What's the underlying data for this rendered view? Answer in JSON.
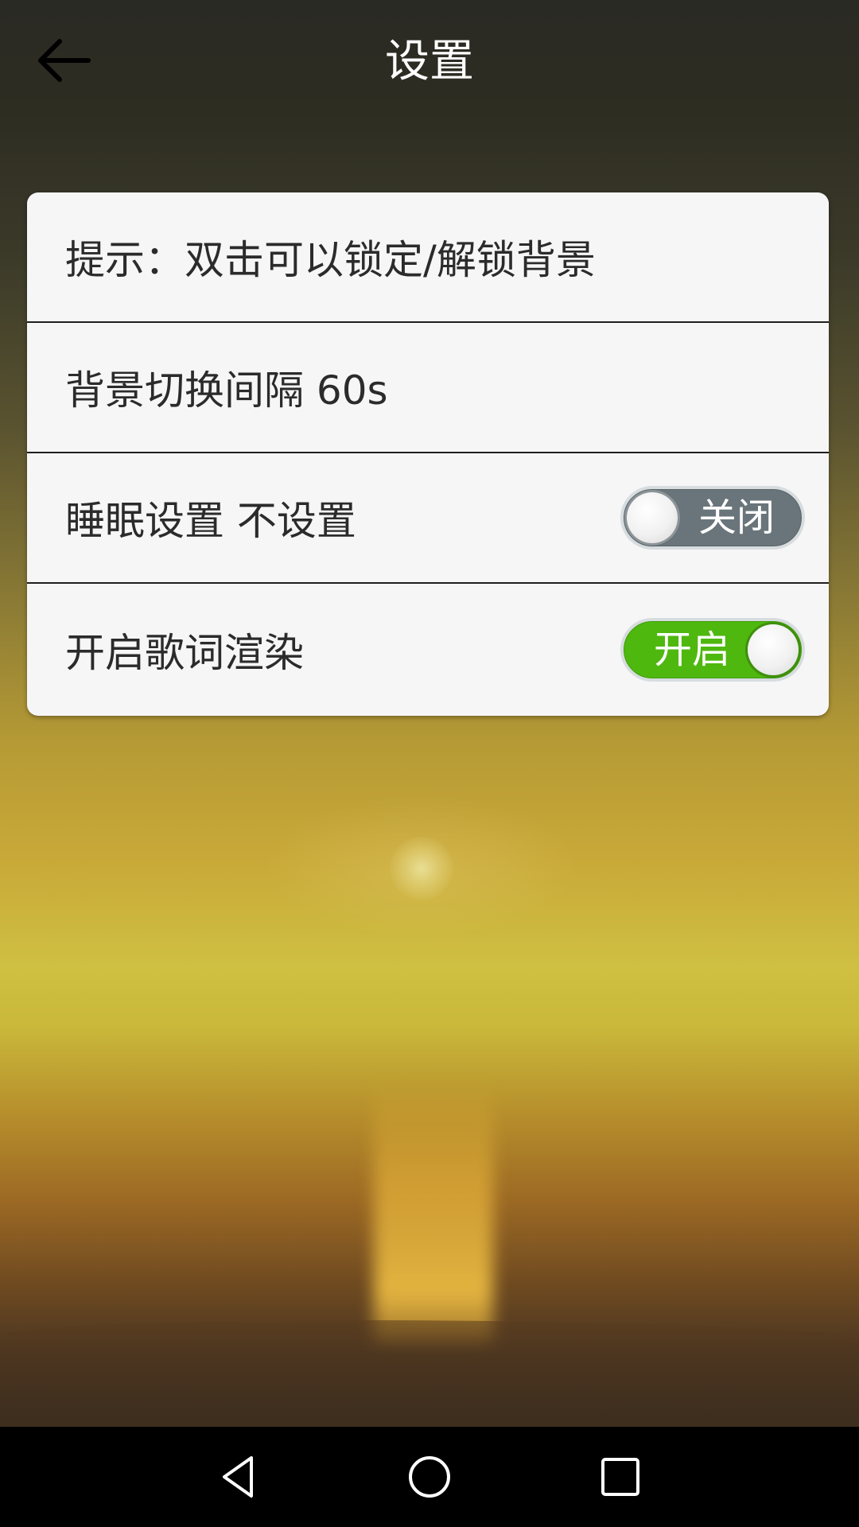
{
  "header": {
    "title": "设置",
    "back_icon": "arrow-left-icon"
  },
  "settings": {
    "hint": "提示：双击可以锁定/解锁背景",
    "bg_interval": "背景切换间隔 60s",
    "sleep_label": "睡眠设置 不设置",
    "sleep_toggle": {
      "text": "关闭",
      "state": "off"
    },
    "lyrics_label": "开启歌词渲染",
    "lyrics_toggle": {
      "text": "开启",
      "state": "on"
    }
  },
  "navbar": {
    "back_icon": "triangle-back-icon",
    "home_icon": "circle-home-icon",
    "recents_icon": "square-recents-icon"
  },
  "colors": {
    "toggle_on": "#4fb80f",
    "toggle_off": "#69757a",
    "card_bg": "#f6f6f7"
  }
}
